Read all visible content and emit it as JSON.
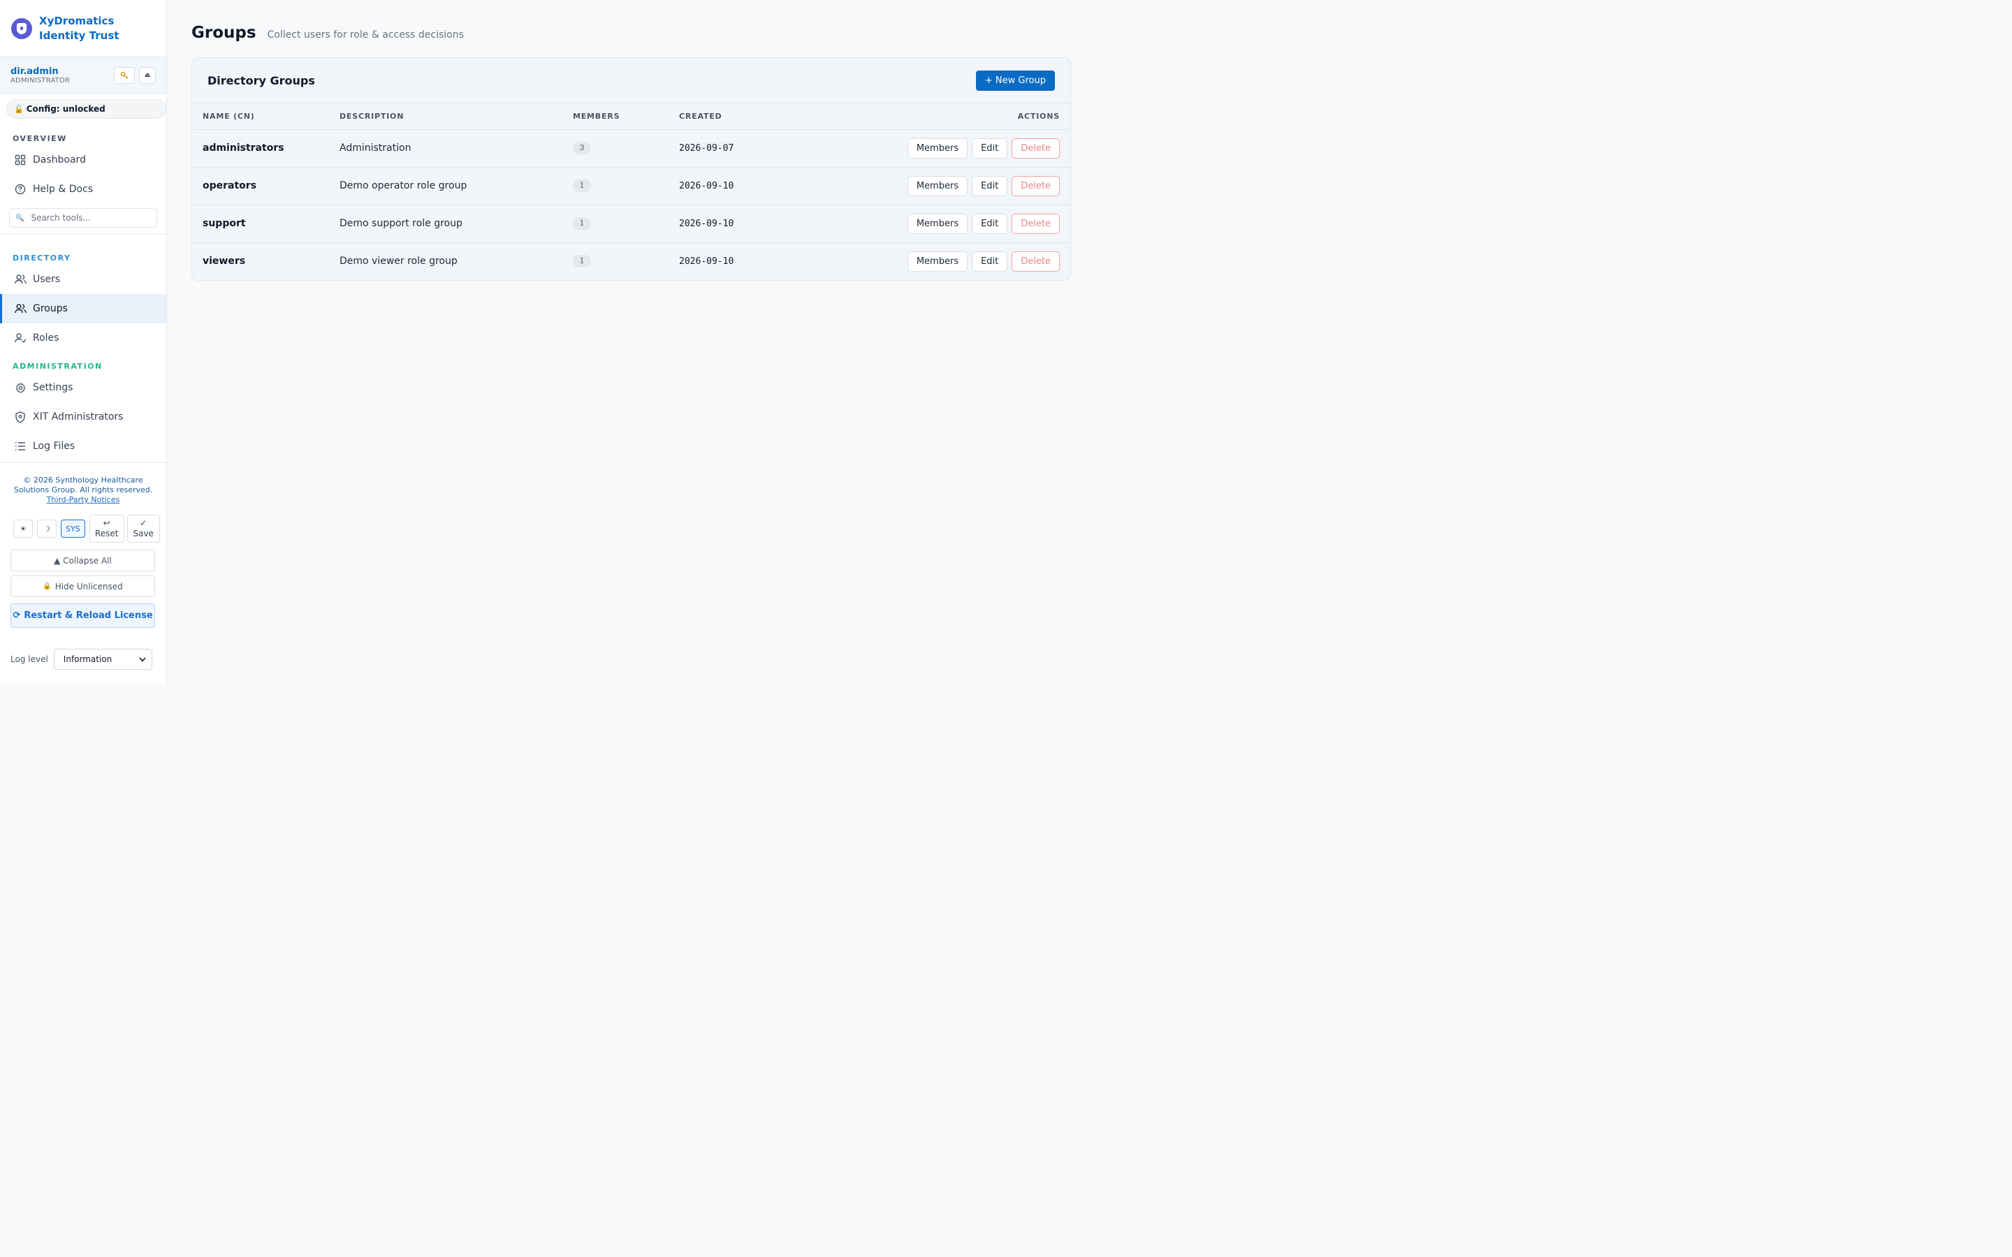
{
  "brand": {
    "title": "XyDromatics Identity Trust"
  },
  "user": {
    "name": "dir.admin",
    "role": "ADMINISTRATOR"
  },
  "config": {
    "label": "Config: unlocked",
    "icon": "lock-open-icon"
  },
  "sidebar": {
    "overview_label": "OVERVIEW",
    "overview_items": [
      {
        "label": "Dashboard",
        "icon": "dashboard-icon"
      },
      {
        "label": "Help & Docs",
        "icon": "help-icon"
      }
    ],
    "search_placeholder": "Search tools...",
    "directory_label": "DIRECTORY",
    "directory_items": [
      {
        "label": "Users",
        "icon": "users-icon"
      },
      {
        "label": "Groups",
        "icon": "groups-icon",
        "active": true
      },
      {
        "label": "Roles",
        "icon": "roles-icon"
      }
    ],
    "admin_label": "ADMINISTRATION",
    "admin_items": [
      {
        "label": "Settings",
        "icon": "gear-icon"
      },
      {
        "label": "XIT Administrators",
        "icon": "shield-icon"
      },
      {
        "label": "Log Files",
        "icon": "list-icon"
      }
    ]
  },
  "footer": {
    "copyright": "© 2026 Synthology Healthcare Solutions Group. All rights reserved.",
    "notices_link": "Third-Party Notices",
    "theme_light": "☀",
    "theme_dark": "☽",
    "theme_sys": "SYS",
    "reset_label": "Reset",
    "save_label": "Save",
    "collapse_label": "▲ Collapse All",
    "hide_unlicensed_label": "Hide Unlicensed",
    "reload_label": "Restart & Reload License",
    "log_level_label": "Log level",
    "log_level_value": "Information"
  },
  "page": {
    "title": "Groups",
    "subtitle": "Collect users for role & access decisions"
  },
  "card": {
    "title": "Directory Groups",
    "new_button": "+ New Group",
    "columns": [
      "NAME (CN)",
      "DESCRIPTION",
      "MEMBERS",
      "CREATED",
      "ACTIONS"
    ],
    "action_labels": {
      "members": "Members",
      "edit": "Edit",
      "delete": "Delete"
    },
    "rows": [
      {
        "name": "administrators",
        "description": "Administration",
        "members": "3",
        "created": "2026-09-07"
      },
      {
        "name": "operators",
        "description": "Demo operator role group",
        "members": "1",
        "created": "2026-09-10"
      },
      {
        "name": "support",
        "description": "Demo support role group",
        "members": "1",
        "created": "2026-09-10"
      },
      {
        "name": "viewers",
        "description": "Demo viewer role group",
        "members": "1",
        "created": "2026-09-10"
      }
    ]
  }
}
